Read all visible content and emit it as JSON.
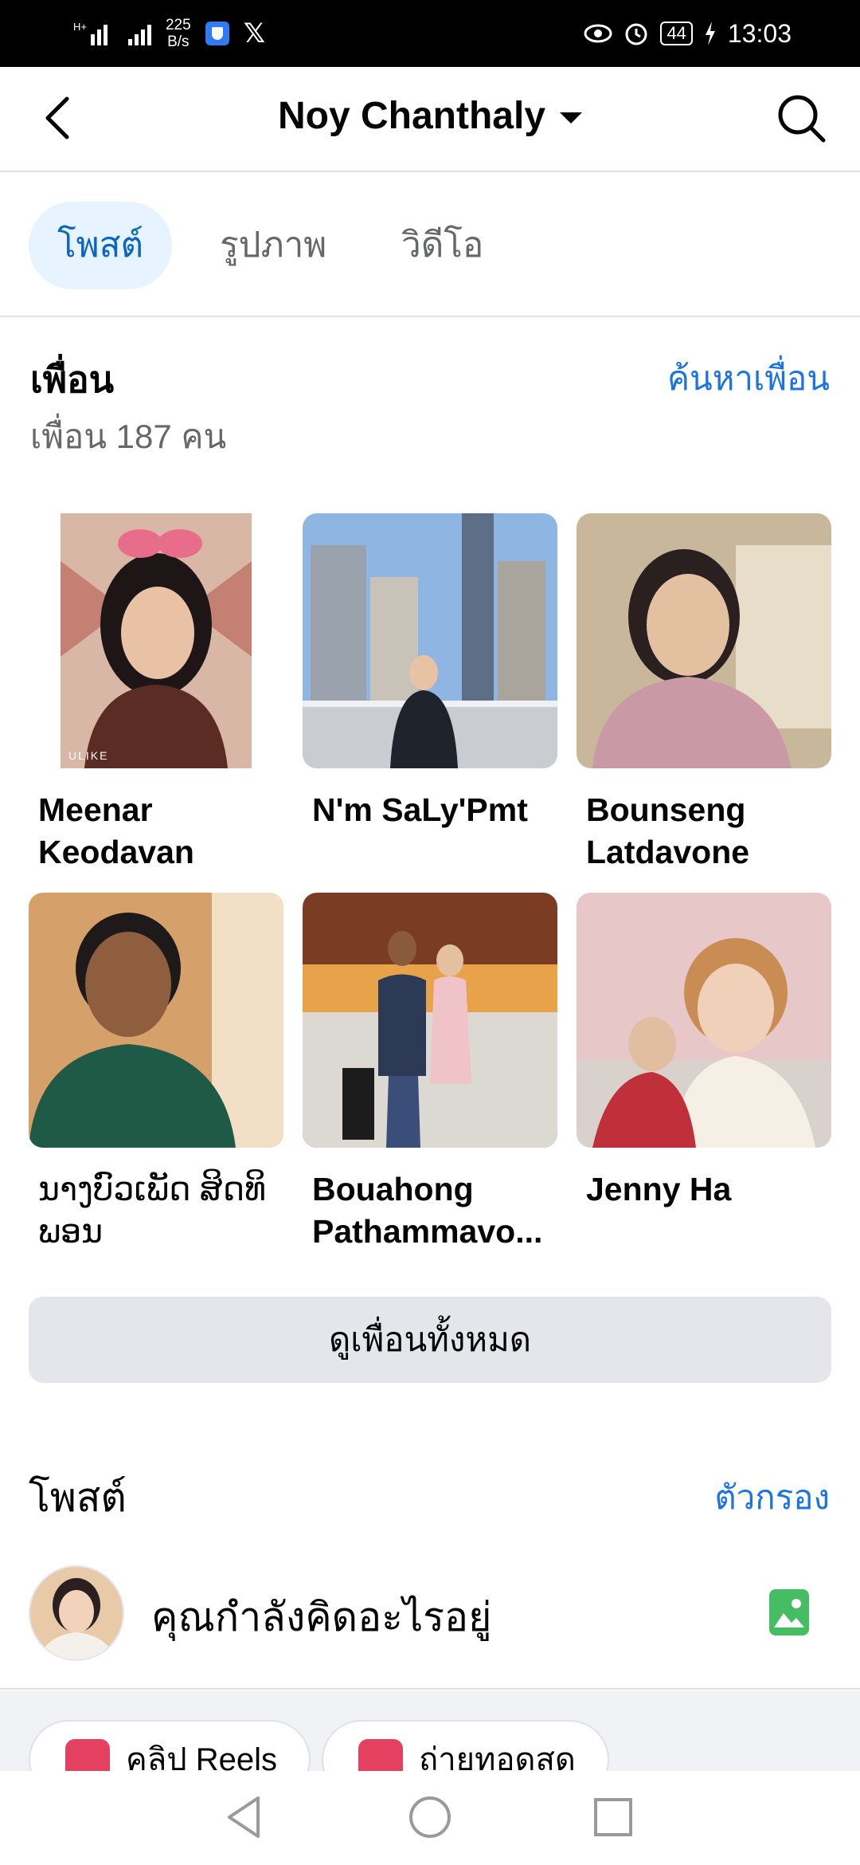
{
  "status_bar": {
    "signal1_tag": "H+",
    "net_speed_value": "225",
    "net_speed_unit": "B/s",
    "battery": "44",
    "time": "13:03"
  },
  "header": {
    "title": "Noy Chanthaly"
  },
  "tabs": [
    {
      "label": "โพสต์",
      "active": true
    },
    {
      "label": "รูปภาพ",
      "active": false
    },
    {
      "label": "วิดีโอ",
      "active": false
    }
  ],
  "friends": {
    "title": "เพื่อน",
    "count_text": "เพื่อน 187 คน",
    "find_link": "ค้นหาเพื่อน",
    "see_all": "ดูเพื่อนทั้งหมด",
    "items": [
      {
        "line1": "Meenar",
        "line2": "Keodavan",
        "overlay": "ULIKE"
      },
      {
        "line1": "N'm SaLy'Pmt",
        "line2": ""
      },
      {
        "line1": "Bounseng",
        "line2": "Latdavone"
      },
      {
        "line1": "ນາງບົວເພັດ ສິດທິ",
        "line2": "ພອນ"
      },
      {
        "line1": "Bouahong",
        "line2": "Pathammavo..."
      },
      {
        "line1": "Jenny Ha",
        "line2": ""
      }
    ]
  },
  "posts": {
    "title": "โพสต์",
    "filter": "ตัวกรอง",
    "composer_placeholder": "คุณกำลังคิดอะไรอยู่",
    "chips": [
      {
        "label": "คลิป Reels"
      },
      {
        "label": "ถ่ายทอดสด"
      }
    ]
  },
  "colors": {
    "accent": "#1b74e4",
    "active_tab_bg": "#e7f3ff",
    "button_bg": "#e4e6eb",
    "photo_green": "#45bd62"
  }
}
